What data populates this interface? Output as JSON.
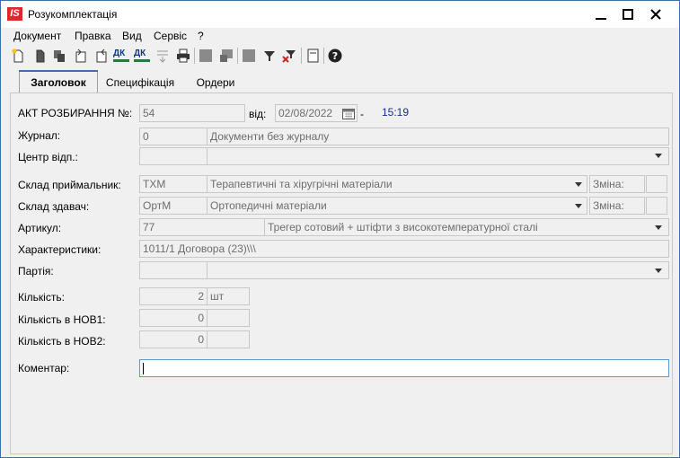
{
  "window": {
    "app_logo": "IS",
    "title": "Розукомплектація"
  },
  "menu": [
    "Документ",
    "Правка",
    "Вид",
    "Сервіс",
    "?"
  ],
  "toolbar": {
    "icons": [
      "new-doc-icon",
      "copy-doc-icon",
      "copy-multi-icon",
      "import-icon",
      "export-icon",
      "debit-credit-icon",
      "debit-credit-alt-icon",
      "post-icon",
      "print-icon",
      "grid-icon",
      "grid-alt-icon",
      "block-icon",
      "filter-icon",
      "clear-filter-icon",
      "notes-icon",
      "help-icon"
    ],
    "debit_credit_label": "ДК"
  },
  "tabs": [
    "Заголовок",
    "Специфікація",
    "Ордери"
  ],
  "form": {
    "act_label": "АКТ РОЗБИРАННЯ №:",
    "act_number": "54",
    "from_label": "від:",
    "date": "02/08/2022",
    "dash": "-",
    "time": "15:19",
    "journal_label": "Журнал:",
    "journal_code": "0",
    "journal_name": "Документи без журналу",
    "center_label": "Центр відп.:",
    "center_code": "",
    "center_name": "",
    "receiver_label": "Склад приймальник:",
    "receiver_code": "ТХМ",
    "receiver_name": "Терапевтичні та хіругрічні матеріали",
    "receiver_shift_label": "Зміна:",
    "sender_label": "Склад здавач:",
    "sender_code": "ОртМ",
    "sender_name": "Ортопедичні матеріали",
    "sender_shift_label": "Зміна:",
    "article_label": "Артикул:",
    "article_code": "77",
    "article_name": "Трегер сотовий + штіфти з високотемпературної сталі",
    "characteristics_label": "Характеристики:",
    "characteristics_value": "1011/1 Договора (23)\\\\\\",
    "batch_label": "Партія:",
    "qty_label": "Кількість:",
    "qty_value": "2",
    "qty_unit": "шт",
    "qty_nov1_label": "Кількість в НОВ1:",
    "qty_nov1_value": "0",
    "qty_nov2_label": "Кількість в НОВ2:",
    "qty_nov2_value": "0",
    "comment_label": "Коментар:",
    "comment_value": ""
  },
  "colors": {
    "accent": "#3c6fb0",
    "logo": "#d92b2b",
    "time": "#1a2e8c"
  }
}
